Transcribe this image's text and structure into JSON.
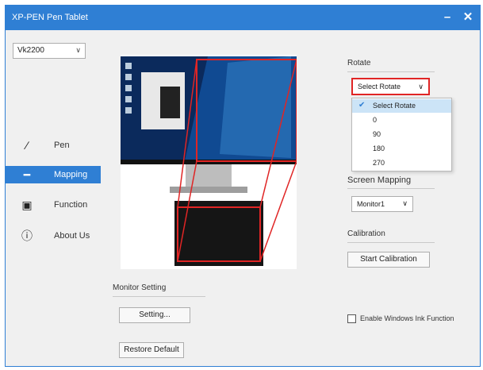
{
  "window": {
    "title": "XP-PEN Pen Tablet",
    "minimize_glyph": "–",
    "close_glyph": "✕"
  },
  "device": {
    "selected": "Vk2200",
    "arrow": "∨"
  },
  "nav": [
    {
      "label": "Pen",
      "icon": "pen-icon",
      "glyph": "∕",
      "active": false
    },
    {
      "label": "Mapping",
      "icon": "mapping-icon",
      "glyph": "━",
      "active": true
    },
    {
      "label": "Function",
      "icon": "function-icon",
      "glyph": "▣",
      "active": false
    },
    {
      "label": "About Us",
      "icon": "info-icon",
      "glyph": "ⓘ",
      "active": false
    }
  ],
  "rotate": {
    "label": "Rotate",
    "selected": "Select Rotate",
    "arrow": "∨",
    "options": [
      "Select Rotate",
      "0",
      "90",
      "180",
      "270"
    ],
    "checked_index": 0,
    "check_glyph": "✔"
  },
  "screen_mapping": {
    "label": "Screen Mapping",
    "selected": "Monitor1",
    "arrow": "∨"
  },
  "calibration": {
    "label": "Calibration",
    "button": "Start Calibration"
  },
  "monitor_setting": {
    "label": "Monitor Setting",
    "button": "Setting..."
  },
  "restore_button": "Restore Default",
  "windows_ink": {
    "label": "Enable Windows Ink Function",
    "checked": false
  },
  "colors": {
    "accent": "#2f7fd4",
    "highlight_red": "#e02525",
    "preview_screen": "#0b2a5c",
    "tablet": "#151515"
  }
}
